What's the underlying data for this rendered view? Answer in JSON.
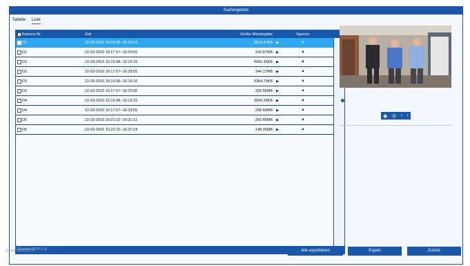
{
  "title": "Suchergebnis",
  "tabs": [
    {
      "label": "Tabelle"
    },
    {
      "label": "Liste"
    }
  ],
  "table": {
    "headers": {
      "camera": "Kamera Nr.",
      "time": "Zeit",
      "size": "Größe Wiedergabe",
      "lock": "Sperren"
    },
    "rows": [
      {
        "camera": "D1",
        "time": "22-03-2016 16:16:09--16:16:14",
        "size": "3613.47KB"
      },
      {
        "camera": "D1",
        "time": "22-03-2016 16:17:57--16:29:55",
        "size": "343.87MB"
      },
      {
        "camera": "D2",
        "time": "22-03-2016 16:16:08--16:16:15",
        "size": "4466.36KB"
      },
      {
        "camera": "D2",
        "time": "22-03-2016 16:17:57--16:29:55",
        "size": "344.17MB"
      },
      {
        "camera": "D3",
        "time": "22-03-2016 16:16:08--16:16:16",
        "size": "4364.79KB"
      },
      {
        "camera": "D3",
        "time": "22-03-2016 16:17:57--16:29:56",
        "size": "350.56MB"
      },
      {
        "camera": "D4",
        "time": "22-03-2016 16:16:08--16:16:15",
        "size": "3540.28KB"
      },
      {
        "camera": "D4",
        "time": "22-03-2016 16:17:57--16:29:55",
        "size": "298.68MB"
      },
      {
        "camera": "D5",
        "time": "22-03-2016 16:21:12--16:31:11",
        "size": "260.46MB"
      },
      {
        "camera": "D6",
        "time": "22-03-2016 16:22:22--16:27:24",
        "size": "148.35MB"
      }
    ],
    "selected_row": 0,
    "footer": "Gesamt:10 P:1 /1",
    "pager": {
      "first": "«",
      "prev": "‹",
      "next": "›",
      "last": "»",
      "go": "⊖"
    }
  },
  "preview": {
    "controls": [
      "◉",
      "⦿",
      "‹",
      "›"
    ]
  },
  "total_size": "Gesamtgröße:0B",
  "buttons": {
    "export_all": "Alle exportieren",
    "export": "Export",
    "back": "Zurück"
  },
  "colors": {
    "primary": "#1a57a8",
    "selected": "#2fa6f0",
    "tab_underline": "#d23c2a"
  }
}
